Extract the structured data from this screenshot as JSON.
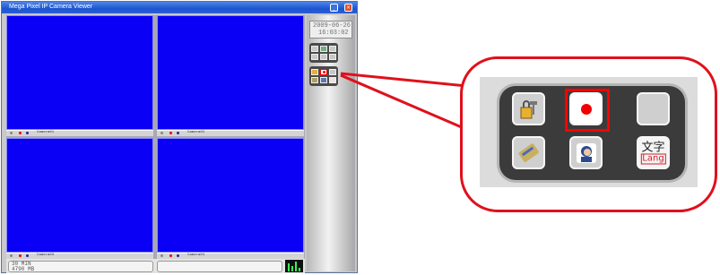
{
  "window": {
    "title": "Mega Pixel IP Camera Viewer",
    "minimize_glyph": "_",
    "close_glyph": "×"
  },
  "cameras": [
    {
      "label": "Camera01"
    },
    {
      "label": "Camera02"
    },
    {
      "label": "Camera03"
    },
    {
      "label": "Camera04"
    }
  ],
  "status": {
    "line1": "30 MIN",
    "line2": "4790 MB"
  },
  "panel": {
    "date": "2009-06-26",
    "time": "16:03:02"
  },
  "callout": {
    "lang_glyph": "文字",
    "lang_label": "Lang"
  },
  "colors": {
    "highlight": "#ff0000",
    "camera_bg": "#0a00f5",
    "titlebar": "#1c55cf"
  },
  "icons": [
    "config-icon",
    "record-icon",
    "blank-icon",
    "search-icon",
    "user-icon",
    "language-icon"
  ]
}
